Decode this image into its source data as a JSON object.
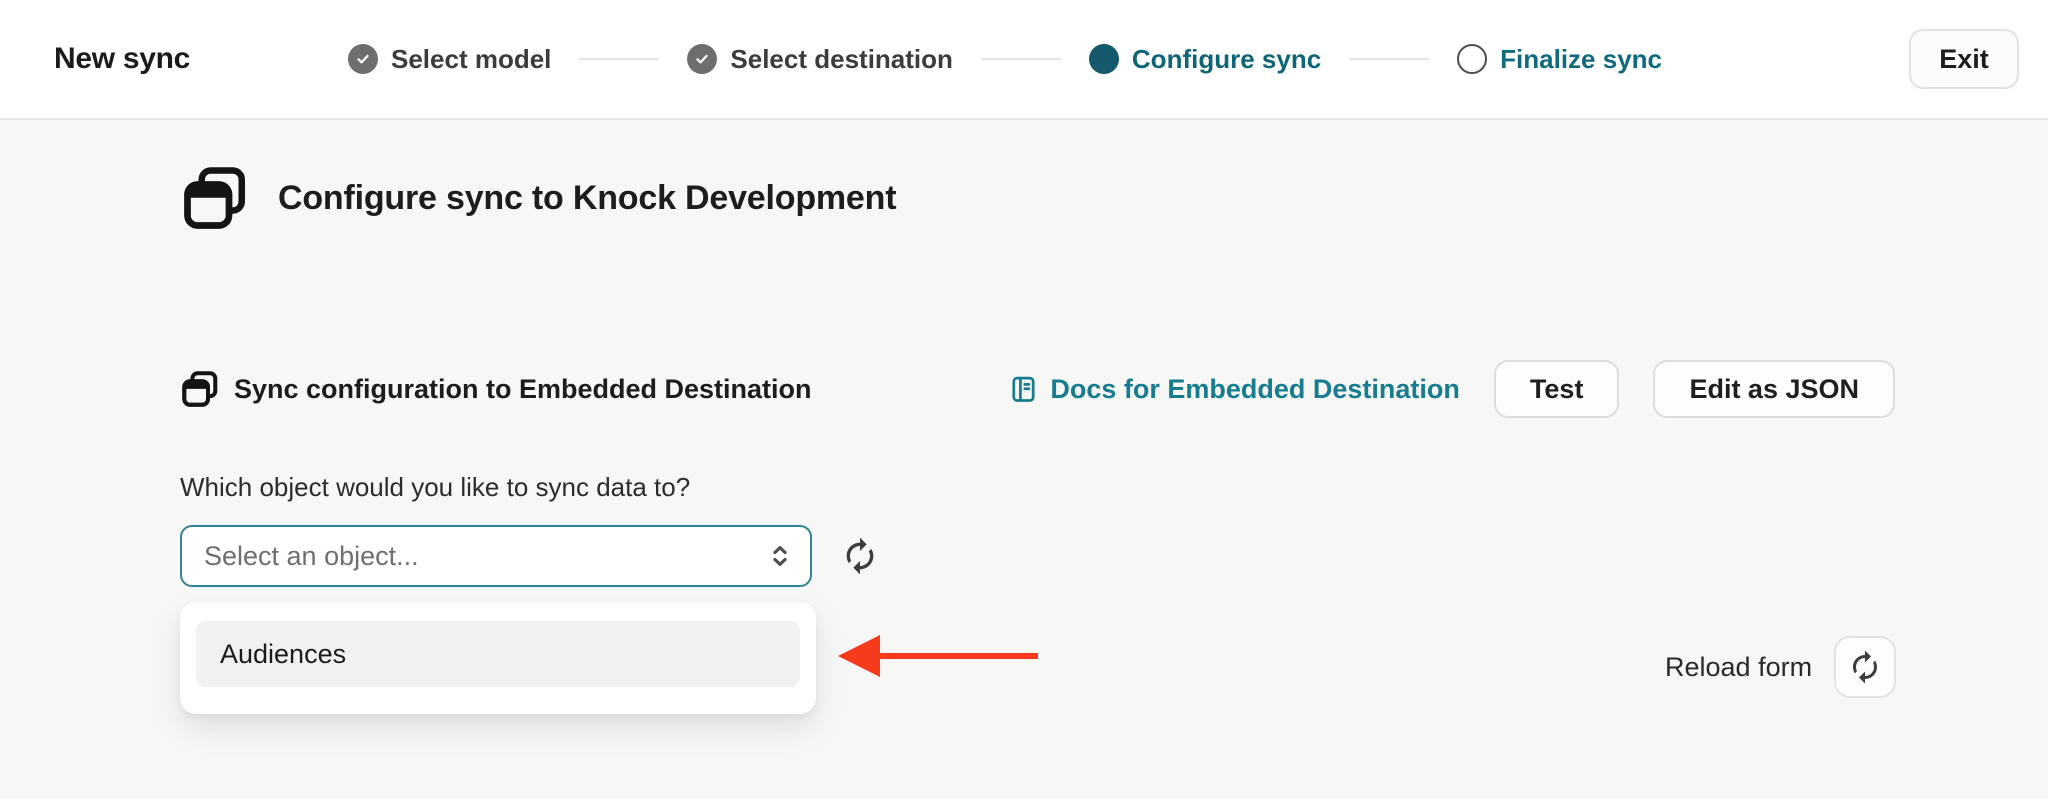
{
  "header": {
    "title": "New sync",
    "exit_label": "Exit",
    "steps": [
      {
        "label": "Select model",
        "state": "done"
      },
      {
        "label": "Select destination",
        "state": "done"
      },
      {
        "label": "Configure sync",
        "state": "active"
      },
      {
        "label": "Finalize sync",
        "state": "upcoming"
      }
    ]
  },
  "main": {
    "page_heading": "Configure sync to Knock Development",
    "section_heading": "Sync configuration to Embedded Destination",
    "docs_link_label": "Docs for Embedded Destination",
    "test_button_label": "Test",
    "edit_json_button_label": "Edit as JSON",
    "object_question": "Which object would you like to sync data to?",
    "select_placeholder": "Select an object...",
    "dropdown_options": [
      "Audiences"
    ],
    "reload_form_label": "Reload form"
  },
  "icons": {
    "step_done": "check-icon",
    "heading": "destination-window-icon",
    "docs": "book-icon",
    "select": "chevron-up-down-icon",
    "refresh": "refresh-icon",
    "annotation": "red-arrow-left"
  },
  "colors": {
    "active_step_circle": "#14596b",
    "active_step_text": "#0e6577",
    "upcoming_step_text": "#0f6a7d",
    "done_step_circle": "#6e6e6e",
    "link_teal": "#177c90",
    "select_border_teal": "#2e8399",
    "annotation_red": "#f43b1d",
    "header_bg": "#ffffff",
    "body_bg": "#f7f7f5",
    "option_bg": "#f1f1ef"
  }
}
